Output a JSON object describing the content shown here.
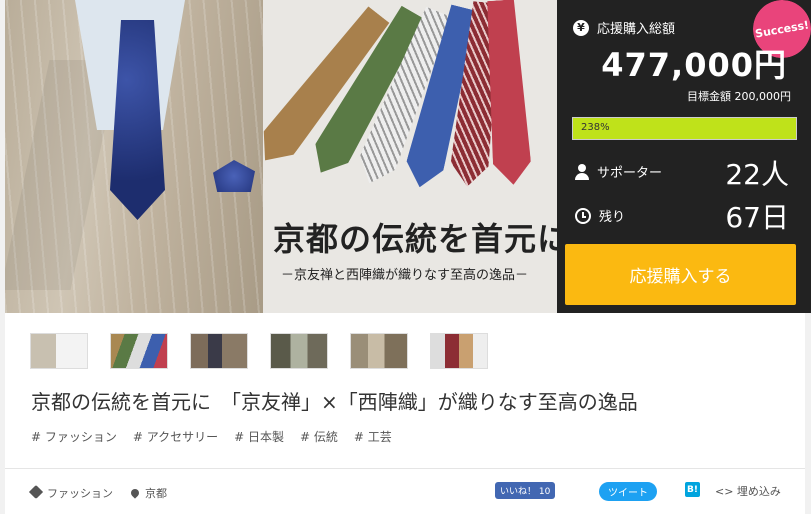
{
  "hero": {
    "title": "京都の伝統を首元に",
    "subtitle": "－京友禅と西陣織が織りなす至高の逸品－"
  },
  "panel": {
    "badge": "Success!",
    "raised_label": "応援購入総額",
    "raised_amount": "477,000円",
    "goal_label": "目標金額 200,000円",
    "progress_text": "238%",
    "progress_fraction": 1.0,
    "supporters_label": "サポーター",
    "supporters_value": "22人",
    "remaining_label": "残り",
    "remaining_value": "67日",
    "cta_label": "応援購入する"
  },
  "colors": {
    "panel_bg": "#222222",
    "progress": "#bfe21a",
    "cta": "#fbb911",
    "badge": "#e9447b"
  },
  "project": {
    "title": "京都の伝統を首元に　「京友禅」×「西陣織」が織りなす至高の逸品",
    "tags": [
      "# ファッション",
      "# アクセサリー",
      "# 日本製",
      "# 伝統",
      "# 工芸"
    ],
    "category": "ファッション",
    "location": "京都"
  },
  "share": {
    "facebook_label": "いいね！ 10",
    "twitter_label": "ツイート",
    "hatena_label": "B!",
    "embed_label": "<> 埋め込み"
  }
}
